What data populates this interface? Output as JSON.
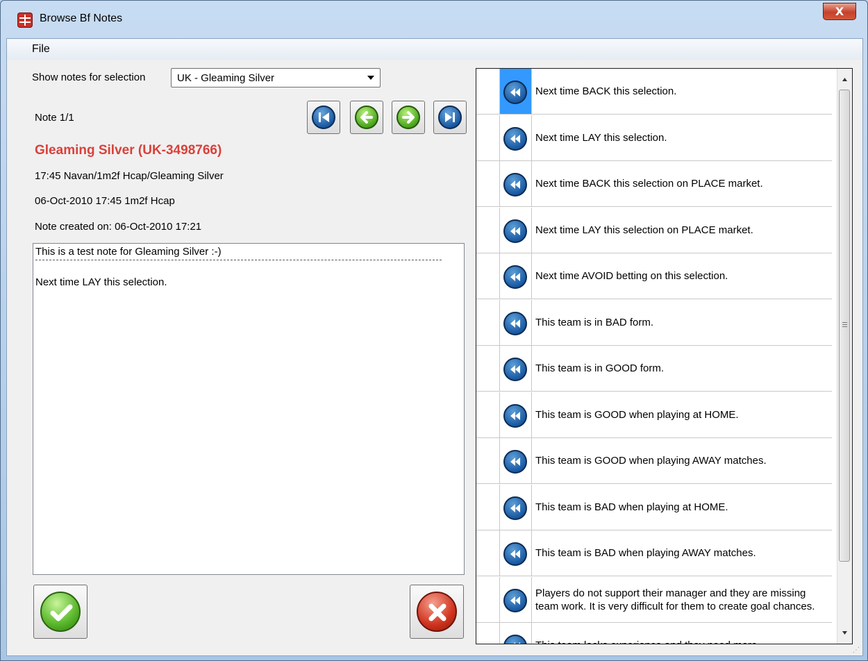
{
  "window": {
    "title": "Browse Bf Notes",
    "close_glyph": "X"
  },
  "menu": {
    "file": "File"
  },
  "selection": {
    "label": "Show notes for selection",
    "value": "UK - Gleaming Silver"
  },
  "note": {
    "counter": "Note 1/1",
    "heading": "Gleaming Silver (UK-3498766)",
    "event_path": "17:45 Navan/1m2f Hcap/Gleaming Silver",
    "event_time": "06-Oct-2010 17:45 1m2f Hcap",
    "created": "Note created on: 06-Oct-2010 17:21",
    "line1": "This is a test note for Gleaming Silver :-)",
    "line2": "Next time LAY this selection."
  },
  "nav": {
    "first_icon": "skip-to-first-icon",
    "prev_icon": "arrow-left-icon",
    "next_icon": "arrow-right-icon",
    "last_icon": "skip-to-last-icon"
  },
  "buttons": {
    "ok_icon": "checkmark-icon",
    "cancel_icon": "cross-icon"
  },
  "templates": [
    "Next time BACK this selection.",
    "Next time LAY this selection.",
    "Next time BACK this selection on PLACE market.",
    "Next time LAY this selection on PLACE market.",
    "Next time AVOID betting on this selection.",
    "This team is in BAD form.",
    "This team is in GOOD form.",
    "This team is GOOD when playing at HOME.",
    "This team is GOOD when playing AWAY matches.",
    "This team is BAD when playing at HOME.",
    "This team is BAD when playing AWAY matches.",
    "Players do not support their manager and they are missing team work. It is very difficult for them to create goal chances.",
    "This team lacks experience and they need more"
  ],
  "colors": {
    "heading": "#d9413a",
    "selected_cell": "#3399ff"
  }
}
